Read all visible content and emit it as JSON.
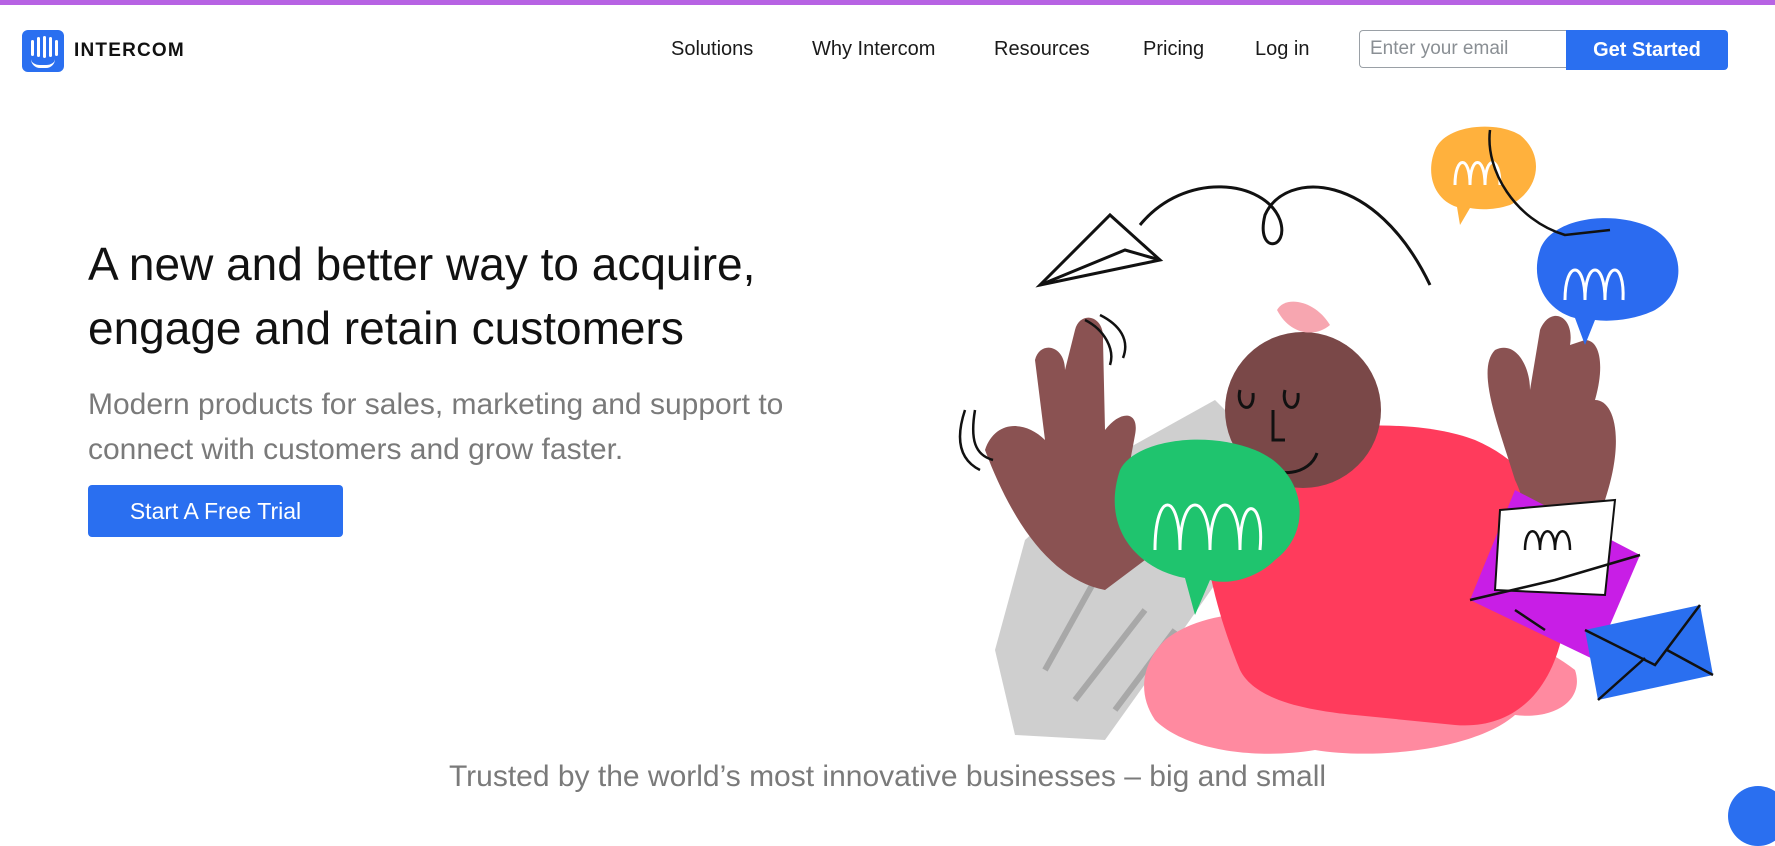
{
  "brand": {
    "name": "INTERCOM",
    "logo_icon": "intercom-logo-icon",
    "accent": "#2a6ff0",
    "top_bar_color": "#b763e3"
  },
  "nav": {
    "items": [
      "Solutions",
      "Why Intercom",
      "Resources",
      "Pricing",
      "Log in"
    ]
  },
  "signup": {
    "email_placeholder": "Enter your email",
    "email_value": "",
    "button_label": "Get Started"
  },
  "hero": {
    "title_line1": "A new and better way to acquire,",
    "title_line2": "engage and retain customers",
    "subtitle_line1": "Modern products for sales, marketing and support to",
    "subtitle_line2": "connect with customers and grow faster.",
    "cta_label": "Start A Free Trial"
  },
  "illustration": {
    "icons": [
      "paper-plane-icon",
      "chat-bubble-icon",
      "envelope-icon"
    ],
    "colors": {
      "skin": "#8a5252",
      "shirt": "#ff3b5c",
      "green_bubble": "#1fc46e",
      "blue_bubble": "#2b6bf0",
      "orange_bubble": "#ffb13d",
      "purple_envelope": "#c81ee6",
      "blue_envelope": "#2a6ff0"
    }
  },
  "trusted": {
    "text": "Trusted by the world’s most innovative businesses – big and small"
  },
  "chat_launcher": {
    "icon": "chat-launcher-icon"
  }
}
